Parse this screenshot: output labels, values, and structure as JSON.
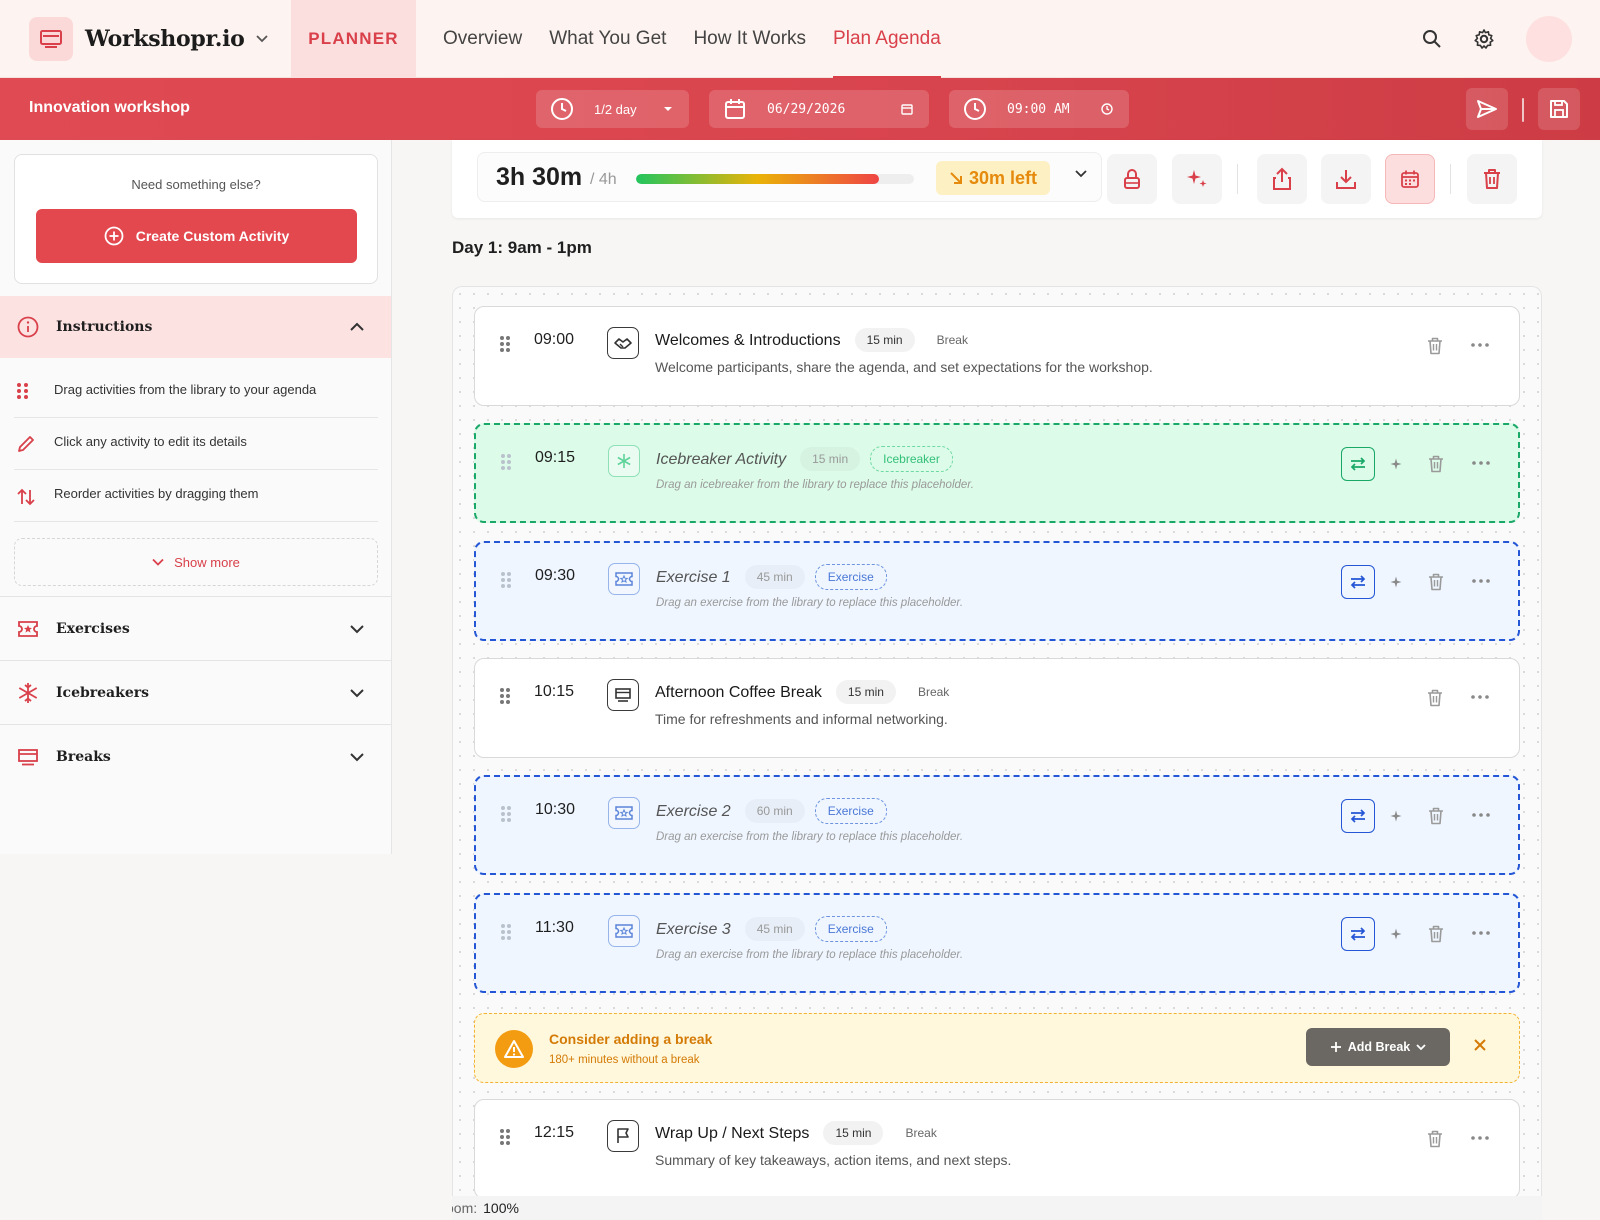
{
  "brand": {
    "name": "Workshopr.io"
  },
  "nav": {
    "planner": "PLANNER",
    "links": [
      "Overview",
      "What You Get",
      "How It Works",
      "Plan Agenda"
    ],
    "active": "Plan Agenda"
  },
  "toolbar": {
    "workshop_title": "Innovation workshop",
    "length": "1/2 day",
    "date": "06/29/2026",
    "start_time": "09:00 AM"
  },
  "sidebar": {
    "need_text": "Need something else?",
    "create_button": "Create Custom Activity",
    "instructions_title": "Instructions",
    "instructions": [
      "Drag activities from the library to your agenda",
      "Click any activity to edit its details",
      "Reorder activities by dragging them"
    ],
    "show_more": "Show more",
    "sections": [
      "Exercises",
      "Icebreakers",
      "Breaks"
    ]
  },
  "summary": {
    "duration": "3h 30m",
    "of_total": "/ 4h",
    "progress_fraction": 0.875,
    "remaining": "30m left"
  },
  "day": {
    "title": "Day 1: 9am - 1pm"
  },
  "agenda": [
    {
      "time": "09:00",
      "title": "Welcomes & Introductions",
      "duration": "15 min",
      "tag": "Break",
      "desc": "Welcome participants, share the agenda, and set expectations for the workshop.",
      "kind": "plain",
      "icon": "handshake-icon"
    },
    {
      "time": "09:15",
      "title": "Icebreaker Activity",
      "duration": "15 min",
      "tag": "Icebreaker",
      "desc": "Drag an icebreaker from the library to replace this placeholder.",
      "kind": "ice",
      "icon": "snowflake-icon"
    },
    {
      "time": "09:30",
      "title": "Exercise 1",
      "duration": "45 min",
      "tag": "Exercise",
      "desc": "Drag an exercise from the library to replace this placeholder.",
      "kind": "ex",
      "icon": "ticket-icon"
    },
    {
      "time": "10:15",
      "title": "Afternoon Coffee Break",
      "duration": "15 min",
      "tag": "Break",
      "desc": "Time for refreshments and informal networking.",
      "kind": "plain",
      "icon": "coffee-icon"
    },
    {
      "time": "10:30",
      "title": "Exercise 2",
      "duration": "60 min",
      "tag": "Exercise",
      "desc": "Drag an exercise from the library to replace this placeholder.",
      "kind": "ex",
      "icon": "ticket-icon"
    },
    {
      "time": "11:30",
      "title": "Exercise 3",
      "duration": "45 min",
      "tag": "Exercise",
      "desc": "Drag an exercise from the library to replace this placeholder.",
      "kind": "ex",
      "icon": "ticket-icon"
    },
    {
      "time": "12:15",
      "title": "Wrap Up / Next Steps",
      "duration": "15 min",
      "tag": "Break",
      "desc": "Summary of key takeaways, action items, and next steps.",
      "kind": "plain",
      "icon": "flag-icon"
    }
  ],
  "warning": {
    "title": "Consider adding a break",
    "subtitle": "180+ minutes without a break",
    "button": "Add Break"
  },
  "zoom": {
    "label": "oom:",
    "value": "100%"
  },
  "colors": {
    "accent": "#e3484f",
    "icebreaker": "#1aa869",
    "exercise": "#2456d6",
    "warning": "#f39c12"
  }
}
